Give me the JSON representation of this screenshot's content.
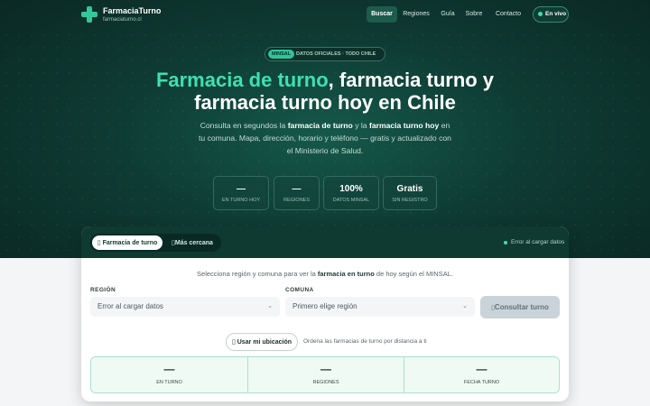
{
  "nav": {
    "brand": "FarmaciaTurno",
    "domain": "farmaciaturno.cl",
    "links": [
      "Buscar",
      "Regiones",
      "Guía",
      "Sobre",
      "Contacto"
    ],
    "live": "En vivo"
  },
  "hero": {
    "badge_tag": "MINSAL",
    "badge_text": "DATOS OFICIALES · TODO CHILE",
    "title_accent": "Farmacia de turno",
    "title_rest": ", farmacia turno y farmacia turno hoy en Chile",
    "subtitle": {
      "p1": "Consulta en segundos la ",
      "b1": "farmacia de turno",
      "p2": " y la ",
      "b2": "farmacia turno hoy",
      "p3": " en tu comuna. Mapa, dirección, horario y teléfono — gratis y actualizado con el Ministerio de Salud."
    },
    "stats": [
      {
        "value": "—",
        "label": "EN TURNO HOY"
      },
      {
        "value": "—",
        "label": "REGIONES"
      },
      {
        "value": "100%",
        "label": "DATOS MINSAL"
      },
      {
        "value": "Gratis",
        "label": "SIN REGISTRO"
      }
    ]
  },
  "search": {
    "tabs": [
      "Farmacia de turno",
      "Más cercana"
    ],
    "status": "Error al cargar datos",
    "intro": {
      "p1": "Selecciona región y comuna para ver la ",
      "b1": "farmacia en turno",
      "p2": " de hoy según el MINSAL."
    },
    "region_label": "REGIÓN",
    "region_value": "Error al cargar datos",
    "comuna_label": "COMUNA",
    "comuna_value": "Primero elige región",
    "consult": "Consultar turno",
    "locate": "Usar mi ubicación",
    "locate_hint": "Ordena las farmacias de turno por distancia a ti",
    "summary": [
      {
        "value": "—",
        "label": "EN TURNO"
      },
      {
        "value": "—",
        "label": "REGIONES"
      },
      {
        "value": "—",
        "label": "FECHA TURNO"
      }
    ]
  },
  "icons": {
    "brand": "medical-cross-icon",
    "live": "live-dot-icon",
    "tab1": "pharmacy-icon",
    "tab2": "location-pin-icon",
    "consult": "search-icon",
    "locate": "crosshair-icon",
    "chevron": "chevron-down-icon"
  },
  "colors": {
    "accent": "#3fe0b0",
    "hero_dark": "#0a2622",
    "card_head": "#0f3a32",
    "summary_bg": "#effaf5"
  }
}
